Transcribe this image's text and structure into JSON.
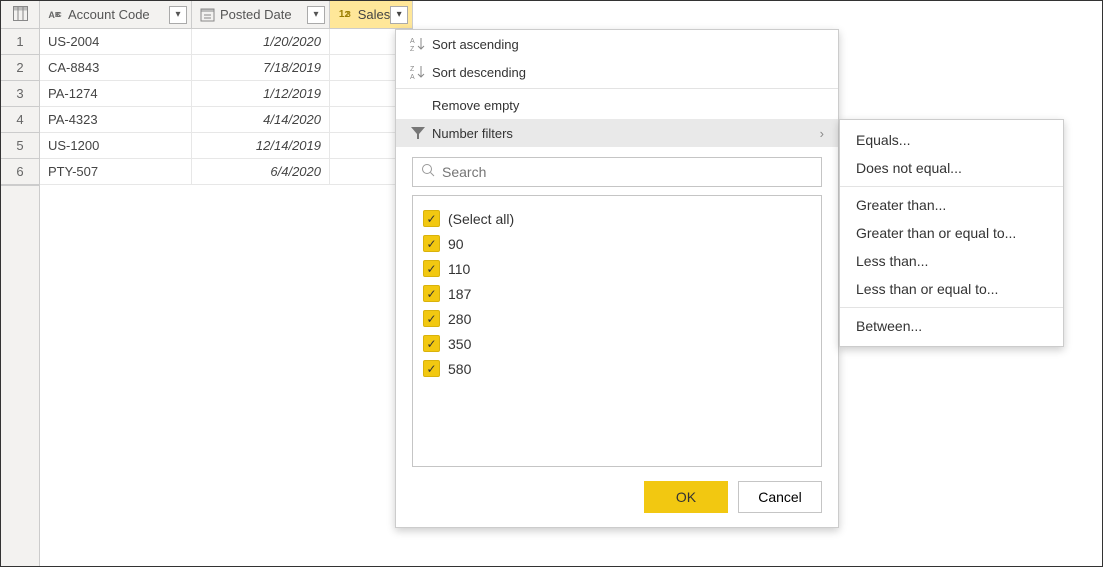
{
  "columns": {
    "a": {
      "label": "Account Code",
      "type": "text"
    },
    "b": {
      "label": "Posted Date",
      "type": "date"
    },
    "c": {
      "label": "Sales",
      "type": "number"
    }
  },
  "rows": [
    {
      "n": "1",
      "a": "US-2004",
      "b": "1/20/2020",
      "c": ""
    },
    {
      "n": "2",
      "a": "CA-8843",
      "b": "7/18/2019",
      "c": ""
    },
    {
      "n": "3",
      "a": "PA-1274",
      "b": "1/12/2019",
      "c": ""
    },
    {
      "n": "4",
      "a": "PA-4323",
      "b": "4/14/2020",
      "c": ""
    },
    {
      "n": "5",
      "a": "US-1200",
      "b": "12/14/2019",
      "c": ""
    },
    {
      "n": "6",
      "a": "PTY-507",
      "b": "6/4/2020",
      "c": ""
    }
  ],
  "menu": {
    "sort_asc": "Sort ascending",
    "sort_desc": "Sort descending",
    "remove_empty": "Remove empty",
    "number_filters": "Number filters",
    "search_placeholder": "Search",
    "select_all": "(Select all)",
    "values": [
      "90",
      "110",
      "187",
      "280",
      "350",
      "580"
    ],
    "ok": "OK",
    "cancel": "Cancel"
  },
  "submenu": {
    "equals": "Equals...",
    "does_not_equal": "Does not equal...",
    "greater_than": "Greater than...",
    "gte": "Greater than or equal to...",
    "less_than": "Less than...",
    "lte": "Less than or equal to...",
    "between": "Between..."
  }
}
